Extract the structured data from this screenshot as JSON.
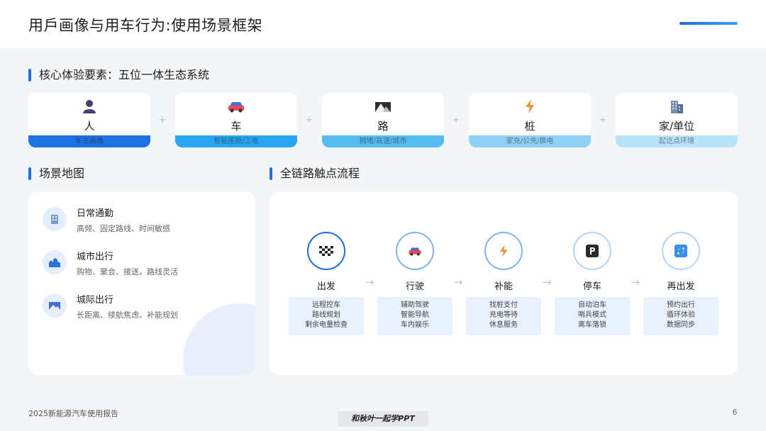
{
  "header": {
    "title": "用戶画像与用车行为:使用场景框架"
  },
  "ecosystem": {
    "title": "核心体验要素：五位一体生态系统",
    "items": [
      {
        "name": "人",
        "desc": "车主画像",
        "icon": "person-icon",
        "color": "#1b72e0"
      },
      {
        "name": "车",
        "desc": "智能座舱/三电",
        "icon": "car-icon",
        "color": "#2aa6f0"
      },
      {
        "name": "路",
        "desc": "拥堵/高速/城市",
        "icon": "road-icon",
        "color": "#56bdf2"
      },
      {
        "name": "桩",
        "desc": "家充/公充/换电",
        "icon": "lightning-icon",
        "color": "#8fd1f5"
      },
      {
        "name": "家/单位",
        "desc": "起讫点环境",
        "icon": "building-icon",
        "color": "#b9e3f8"
      }
    ]
  },
  "scenario_map": {
    "title": "场景地图",
    "items": [
      {
        "title": "日常通勤",
        "desc": "高频、固定路线、时间敏感",
        "icon": "office-building-icon"
      },
      {
        "title": "城市出行",
        "desc": "购物、聚会、接送，路线灵活",
        "icon": "city-icon"
      },
      {
        "title": "城际出行",
        "desc": "长距离、续航焦虑、补能规划",
        "icon": "landscape-icon"
      }
    ]
  },
  "flow": {
    "title": "全链路触点流程",
    "steps": [
      {
        "label": "出发",
        "icon": "checkered-flag-icon",
        "lines": [
          "远程控车",
          "路线规划",
          "剩余电量检查"
        ]
      },
      {
        "label": "行驶",
        "icon": "car-icon",
        "lines": [
          "辅助驾驶",
          "智能导航",
          "车内娱乐"
        ]
      },
      {
        "label": "补能",
        "icon": "lightning-icon",
        "lines": [
          "找桩支付",
          "充电等待",
          "休息服务"
        ]
      },
      {
        "label": "停车",
        "icon": "parking-icon",
        "lines": [
          "自动泊车",
          "哨兵模式",
          "离车落锁"
        ]
      },
      {
        "label": "再出发",
        "icon": "refresh-icon",
        "lines": [
          "预约出行",
          "循环体验",
          "数据同步"
        ]
      }
    ]
  },
  "footer": {
    "report": "2025新能源汽车使用报告",
    "page": "6",
    "watermark": "和秋叶一起学PPT"
  }
}
